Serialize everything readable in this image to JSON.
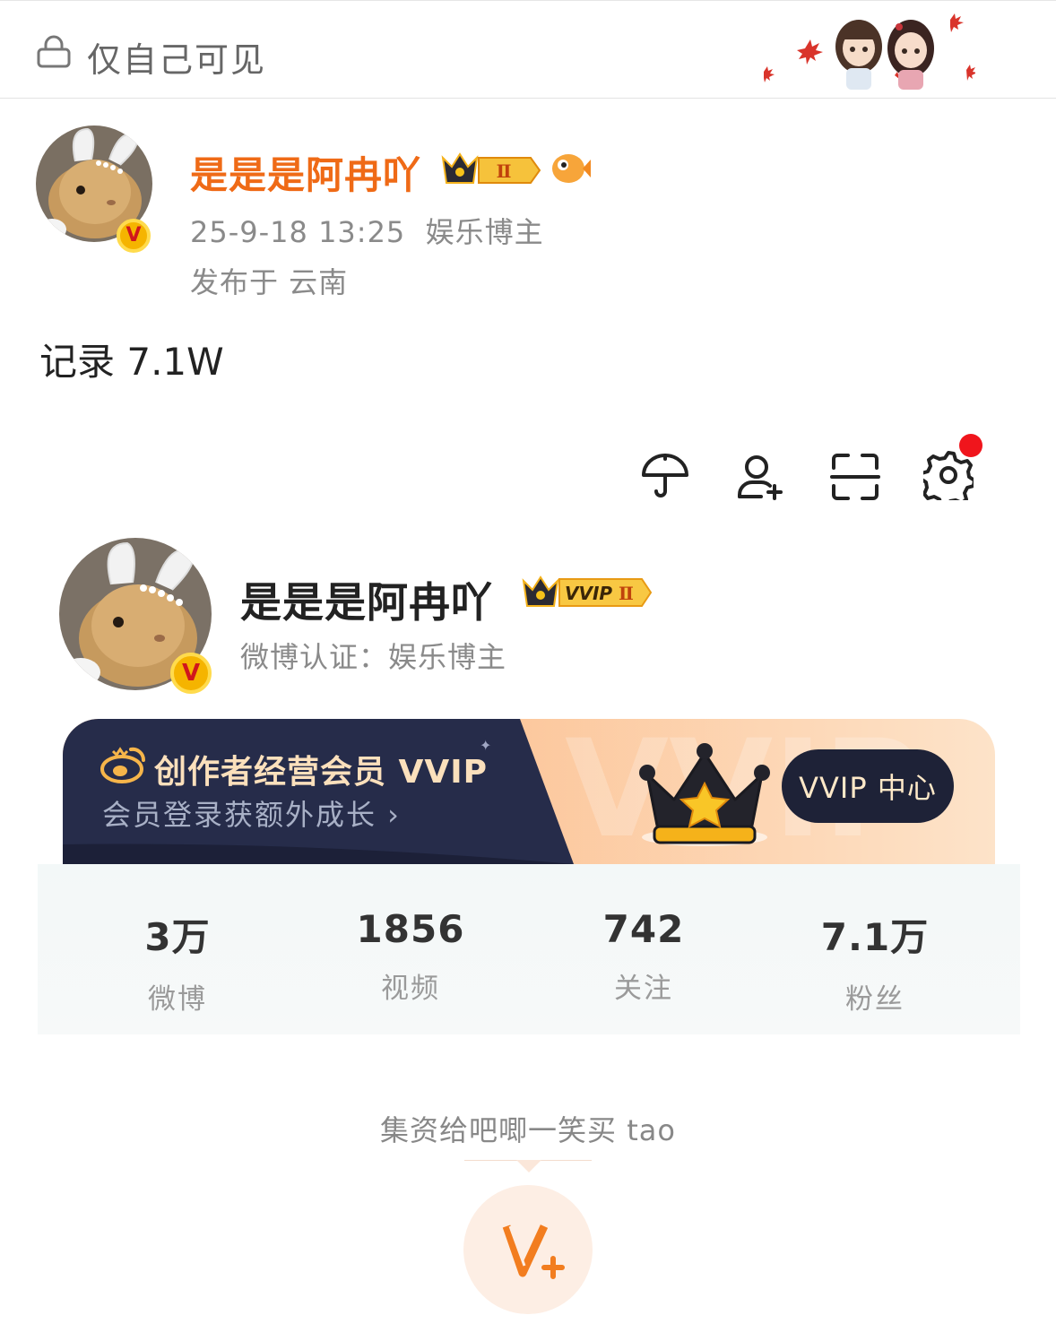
{
  "top_bar": {
    "visibility_label": "仅自己可见",
    "lock_icon": "lock-icon",
    "decoration": "chibi-characters-with-maple-leaves"
  },
  "post": {
    "author_name": "是是是阿冉吖",
    "crown_badge_level": "Ⅱ",
    "datetime": "25-9-18 13:25",
    "author_tag": "娱乐博主",
    "location": "发布于 云南",
    "content": "记录 7.1W"
  },
  "toolbar": {
    "icons": [
      "umbrella-icon",
      "add-user-icon",
      "scan-icon",
      "settings-icon"
    ],
    "settings_has_notification": true
  },
  "profile": {
    "name": "是是是阿冉吖",
    "vvip_badge": "VVIP",
    "vvip_level": "Ⅱ",
    "certification": "微博认证：娱乐博主"
  },
  "vvip_banner": {
    "title": "创作者经营会员 VVIP",
    "subtitle": "会员登录获额外成长 ›",
    "button_label": "VVIP 中心",
    "watermark": "VVIP"
  },
  "stats": [
    {
      "value": "3万",
      "label": "微博"
    },
    {
      "value": "1856",
      "label": "视频"
    },
    {
      "value": "742",
      "label": "关注"
    },
    {
      "value": "7.1万",
      "label": "粉丝"
    }
  ],
  "footer": {
    "slogan": "集资给吧唧一笑买 tao",
    "v_plus_icon": "v-plus-icon"
  },
  "colors": {
    "name_orange": "#ef6a16",
    "verified_gold": "#f5b400",
    "banner_dark": "#23294a",
    "banner_orange": "#fcb780",
    "notification_red": "#f0151c"
  }
}
